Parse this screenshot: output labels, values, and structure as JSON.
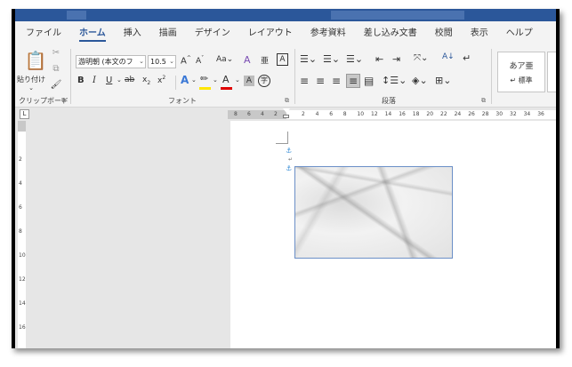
{
  "tabs": [
    "ファイル",
    "ホーム",
    "挿入",
    "描画",
    "デザイン",
    "レイアウト",
    "参考資料",
    "差し込み文書",
    "校閲",
    "表示",
    "ヘルプ"
  ],
  "active_tab_index": 1,
  "clipboard": {
    "paste_label": "貼り付け",
    "group_label": "クリップボード"
  },
  "font": {
    "name": "游明朝 (本文のフ",
    "size": "10.5",
    "case_label": "Aa",
    "group_label": "フォント"
  },
  "paragraph": {
    "group_label": "段落"
  },
  "styles": {
    "sample": "あア亜",
    "name": "↵ 標準"
  },
  "ruler": {
    "left_numbers": [
      "8",
      "6",
      "4",
      "2"
    ],
    "right_numbers": [
      "2",
      "4",
      "6",
      "8",
      "10",
      "12",
      "14",
      "16",
      "18",
      "20",
      "22",
      "24",
      "26",
      "28",
      "30",
      "32",
      "34",
      "36"
    ],
    "tab_selector": "L"
  },
  "vruler_numbers": [
    "2",
    "4",
    "6",
    "8",
    "10",
    "12",
    "14",
    "16"
  ],
  "colors": {
    "accent": "#2b579a",
    "highlight": "#ffe600",
    "font_color": "#e00000"
  }
}
